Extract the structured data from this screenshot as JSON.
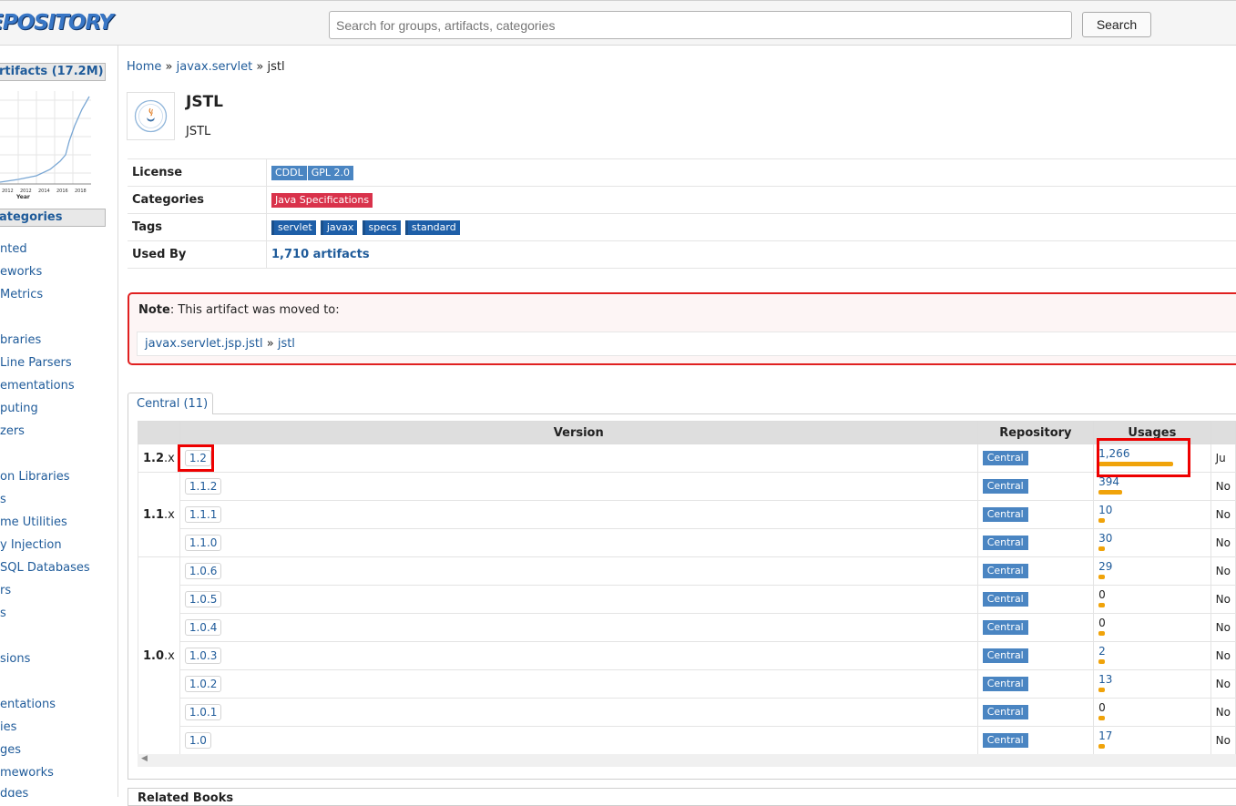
{
  "header": {
    "logo_text": "EPOSITORY",
    "search_placeholder": "Search for groups, artifacts, categories",
    "search_button": "Search"
  },
  "sidebar": {
    "artifacts_head": "rtifacts (17.2M)",
    "categories_head": "ategories",
    "chart_labels": [
      "2012",
      "2012",
      "2014",
      "2016",
      "2018",
      "Year"
    ],
    "items": [
      "nted",
      "eworks",
      "Metrics",
      "braries",
      "Line Parsers",
      "ementations",
      "puting",
      "zers",
      "on Libraries",
      "s",
      "me Utilities",
      "y Injection",
      "SQL Databases",
      "rs",
      "s",
      "sions",
      "entations",
      "ies",
      "ges",
      "meworks",
      "dges"
    ]
  },
  "breadcrumb": {
    "home": "Home",
    "sep": "»",
    "group": "javax.servlet",
    "artifact": "jstl"
  },
  "artifact": {
    "title": "JSTL",
    "subtitle": "JSTL"
  },
  "info": {
    "license_label": "License",
    "licenses": [
      "CDDL",
      "GPL 2.0"
    ],
    "categories_label": "Categories",
    "category": "Java Specifications",
    "tags_label": "Tags",
    "tags": [
      "servlet",
      "javax",
      "specs",
      "standard"
    ],
    "used_by_label": "Used By",
    "used_by": "1,710 artifacts"
  },
  "note": {
    "label": "Note",
    "text": ": This artifact was moved to:",
    "moved_group": "javax.servlet.jsp.jstl",
    "moved_sep": "»",
    "moved_artifact": "jstl"
  },
  "tab": {
    "label": "Central (11)"
  },
  "versions_table": {
    "headers": [
      "Version",
      "Repository",
      "Usages"
    ],
    "groups": [
      {
        "major": "1.2",
        "suffix": ".x"
      },
      {
        "major": "1.1",
        "suffix": ".x"
      },
      {
        "major": "1.0",
        "suffix": ".x"
      }
    ],
    "rows": [
      {
        "version": "1.2",
        "repo": "Central",
        "usages": "1,266",
        "usage_fraction": 1.0,
        "date": "Ju"
      },
      {
        "version": "1.1.2",
        "repo": "Central",
        "usages": "394",
        "usage_fraction": 0.311,
        "date": "No"
      },
      {
        "version": "1.1.1",
        "repo": "Central",
        "usages": "10",
        "usage_fraction": 0.008,
        "date": "No"
      },
      {
        "version": "1.1.0",
        "repo": "Central",
        "usages": "30",
        "usage_fraction": 0.024,
        "date": "No"
      },
      {
        "version": "1.0.6",
        "repo": "Central",
        "usages": "29",
        "usage_fraction": 0.023,
        "date": "No"
      },
      {
        "version": "1.0.5",
        "repo": "Central",
        "usages": "0",
        "usage_fraction": 0,
        "date": "No"
      },
      {
        "version": "1.0.4",
        "repo": "Central",
        "usages": "0",
        "usage_fraction": 0,
        "date": "No"
      },
      {
        "version": "1.0.3",
        "repo": "Central",
        "usages": "2",
        "usage_fraction": 0.002,
        "date": "No"
      },
      {
        "version": "1.0.2",
        "repo": "Central",
        "usages": "13",
        "usage_fraction": 0.01,
        "date": "No"
      },
      {
        "version": "1.0.1",
        "repo": "Central",
        "usages": "0",
        "usage_fraction": 0,
        "date": "No"
      },
      {
        "version": "1.0",
        "repo": "Central",
        "usages": "17",
        "usage_fraction": 0.013,
        "date": "No"
      }
    ]
  },
  "related": {
    "title": "Related Books"
  },
  "colors": {
    "link": "#1f5b9a",
    "badge_blue": "#4a85c2",
    "badge_red": "#d9324b",
    "usage_bar": "#f0a30a",
    "highlight": "#e00000"
  }
}
